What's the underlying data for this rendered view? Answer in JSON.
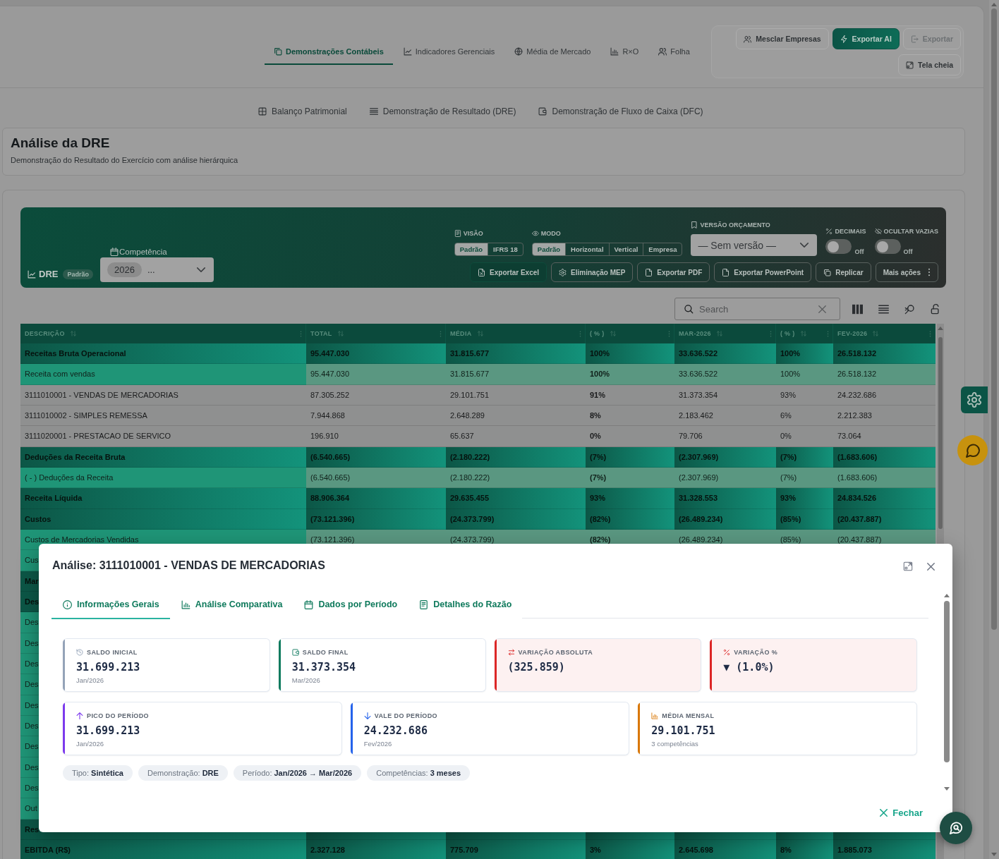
{
  "main_tabs": [
    {
      "label": "Demonstrações Contábeis",
      "selected": true
    },
    {
      "label": "Indicadores Gerenciais",
      "selected": false
    },
    {
      "label": "Média de Mercado",
      "selected": false
    },
    {
      "label": "R×O",
      "selected": false
    },
    {
      "label": "Folha",
      "selected": false
    }
  ],
  "actions": [
    [
      {
        "label": "Mesclar Empresas",
        "kind": "outline",
        "disabled": false
      },
      {
        "label": "Exportar AI",
        "kind": "primary",
        "disabled": false
      },
      {
        "label": "Exportar",
        "kind": "outline",
        "disabled": true
      }
    ],
    [
      {
        "label": "Tela cheia",
        "kind": "outline",
        "disabled": false
      }
    ]
  ],
  "statement_tabs": [
    "Balanço Patrimonial",
    "Demonstração de Resultado (DRE)",
    "Demonstração de Fluxo de Caixa (DFC)"
  ],
  "page_header": {
    "title": "Análise da DRE",
    "subtitle": "Demonstração do Resultado do Exercício com análise hierárquica"
  },
  "report_bar": {
    "title": "DRE",
    "badge": "Padrão",
    "period": {
      "label": "Competência",
      "year": "2026",
      "value": "..."
    },
    "view": {
      "label": "VISÃO",
      "options": [
        {
          "label": "Padrão",
          "selected": true
        },
        {
          "label": "IFRS 18",
          "selected": false
        }
      ]
    },
    "mode": {
      "label": "MODO",
      "options": [
        {
          "label": "Padrão",
          "selected": true
        },
        {
          "label": "Horizontal",
          "selected": false
        },
        {
          "label": "Vertical",
          "selected": false
        },
        {
          "label": "Empresa",
          "selected": false
        }
      ]
    },
    "budget_version": {
      "label": "VERSÃO ORÇAMENTO",
      "value": "— Sem versão —"
    },
    "toggles": [
      {
        "label": "DECIMAIS",
        "on": false,
        "state": "Off"
      },
      {
        "label": "OCULTAR VAZIAS",
        "on": false,
        "state": "Off"
      }
    ],
    "buttons": [
      {
        "label": "Exportar Excel",
        "kind": "primary"
      },
      {
        "label": "Eliminação MEP",
        "kind": "outline"
      },
      {
        "label": "Exportar PDF",
        "kind": "outline"
      },
      {
        "label": "Exportar PowerPoint",
        "kind": "outline"
      },
      {
        "label": "Replicar",
        "kind": "outline"
      },
      {
        "label": "Mais ações",
        "kind": "menu"
      }
    ]
  },
  "table": {
    "search": {
      "placeholder": "Search"
    },
    "columns": [
      {
        "label": "DESCRIÇÃO",
        "emphasized": false
      },
      {
        "label": "TOTAL",
        "emphasized": false
      },
      {
        "label": "MÉDIA",
        "emphasized": false
      },
      {
        "label": "( % )",
        "emphasized": true
      },
      {
        "label": "MAR-2026",
        "emphasized": false
      },
      {
        "label": "( % )",
        "emphasized": false
      },
      {
        "label": "FEV-2026",
        "emphasized": false
      }
    ],
    "rows": [
      {
        "kind": "group",
        "cells": [
          "Receitas Bruta Operacional",
          "95.447.030",
          "31.815.677",
          "100%",
          "33.636.522",
          "100%",
          "26.518.132"
        ]
      },
      {
        "kind": "subgroup",
        "cells": [
          "Receita com vendas",
          "95.447.030",
          "31.815.677",
          "100%",
          "33.636.522",
          "100%",
          "26.518.132"
        ]
      },
      {
        "kind": "account",
        "cells": [
          "3111010001 - VENDAS DE MERCADORIAS",
          "87.305.252",
          "29.101.751",
          "91%",
          "31.373.354",
          "93%",
          "24.232.686"
        ]
      },
      {
        "kind": "account",
        "cells": [
          "3111010002 - SIMPLES REMESSA",
          "7.944.868",
          "2.648.289",
          "8%",
          "2.183.462",
          "6%",
          "2.212.383"
        ]
      },
      {
        "kind": "account",
        "cells": [
          "3111020001 - PRESTACAO DE SERVICO",
          "196.910",
          "65.637",
          "0%",
          "79.706",
          "0%",
          "73.064"
        ]
      },
      {
        "kind": "group",
        "cells": [
          "Deduções da Receita Bruta",
          "(6.540.665)",
          "(2.180.222)",
          "(7%)",
          "(2.307.969)",
          "(7%)",
          "(1.683.606)"
        ]
      },
      {
        "kind": "subgroup",
        "cells": [
          "( - ) Deduções da Receita",
          "(6.540.665)",
          "(2.180.222)",
          "(7%)",
          "(2.307.969)",
          "(7%)",
          "(1.683.606)"
        ]
      },
      {
        "kind": "group",
        "cells": [
          "Receita Líquida",
          "88.906.364",
          "29.635.455",
          "93%",
          "31.328.553",
          "93%",
          "24.834.526"
        ]
      },
      {
        "kind": "group",
        "cells": [
          "Custos",
          "(73.121.396)",
          "(24.373.799)",
          "(82%)",
          "(26.489.234)",
          "(85%)",
          "(20.437.887)"
        ]
      },
      {
        "kind": "subgroup",
        "cells": [
          "Custos de Mercadorias Vendidas",
          "(73.121.396)",
          "(24.373.799)",
          "(82%)",
          "(26.489.234)",
          "(85%)",
          "(20.437.887)"
        ]
      },
      {
        "kind": "subgroup",
        "cells": [
          "Cus"
        ]
      },
      {
        "kind": "group",
        "cells": [
          "Mar"
        ]
      },
      {
        "kind": "group",
        "cells": [
          "Des"
        ]
      },
      {
        "kind": "subgroup",
        "cells": [
          "Des"
        ]
      },
      {
        "kind": "subgroup",
        "cells": [
          "Des"
        ]
      },
      {
        "kind": "subgroup",
        "cells": [
          "Des"
        ]
      },
      {
        "kind": "subgroup",
        "cells": [
          "Des"
        ]
      },
      {
        "kind": "subgroup",
        "cells": [
          "Des"
        ]
      },
      {
        "kind": "subgroup",
        "cells": [
          "Des"
        ]
      },
      {
        "kind": "subgroup",
        "cells": [
          "Des"
        ]
      },
      {
        "kind": "subgroup",
        "cells": [
          "Des"
        ]
      },
      {
        "kind": "subgroup",
        "cells": [
          "Des"
        ]
      },
      {
        "kind": "subgroup",
        "cells": [
          "Out"
        ]
      },
      {
        "kind": "group",
        "cells": [
          "Res"
        ]
      },
      {
        "kind": "group",
        "cells": [
          "EBITDA (R$)",
          "2.327.128",
          "775.709",
          "3%",
          "2.645.698",
          "8%",
          "1.885.073"
        ]
      }
    ]
  },
  "modal": {
    "title": "Análise: 3111010001 - VENDAS DE MERCADORIAS",
    "tabs": [
      {
        "label": "Informações Gerais",
        "selected": true
      },
      {
        "label": "Análise Comparativa",
        "selected": false
      },
      {
        "label": "Dados por Período",
        "selected": false
      },
      {
        "label": "Detalhes do Razão",
        "selected": false
      }
    ],
    "card_rows": [
      [
        {
          "label": "SALDO INICIAL",
          "value": "31.699.213",
          "note": "Jan/2026",
          "color": "#94a3b8",
          "negative": false
        },
        {
          "label": "SALDO FINAL",
          "value": "31.373.354",
          "note": "Mar/2026",
          "color": "#0f7b5f",
          "negative": false
        },
        {
          "label": "VARIAÇÃO ABSOLUTA",
          "value": "(325.859)",
          "color": "#dc2626",
          "negative": true
        },
        {
          "label": "VARIAÇÃO %",
          "value": "▼ (1.0%)",
          "color": "#dc2626",
          "negative": true
        }
      ],
      [
        {
          "label": "PICO DO PERÍODO",
          "value": "31.699.213",
          "note": "Jan/2026",
          "color": "#7c3aed",
          "negative": false
        },
        {
          "label": "VALE DO PERÍODO",
          "value": "24.232.686",
          "note": "Fev/2026",
          "color": "#2563eb",
          "negative": false
        },
        {
          "label": "MÉDIA MENSAL",
          "value": "29.101.751",
          "note": "3 competências",
          "color": "#d97706",
          "negative": false
        }
      ]
    ],
    "chips": [
      "Tipo: **Sintética**",
      "Demonstração: **DRE**",
      "Período: **Jan/2026 → Mar/2026**",
      "Competências: **3 meses**"
    ],
    "close_button": "Fechar"
  }
}
